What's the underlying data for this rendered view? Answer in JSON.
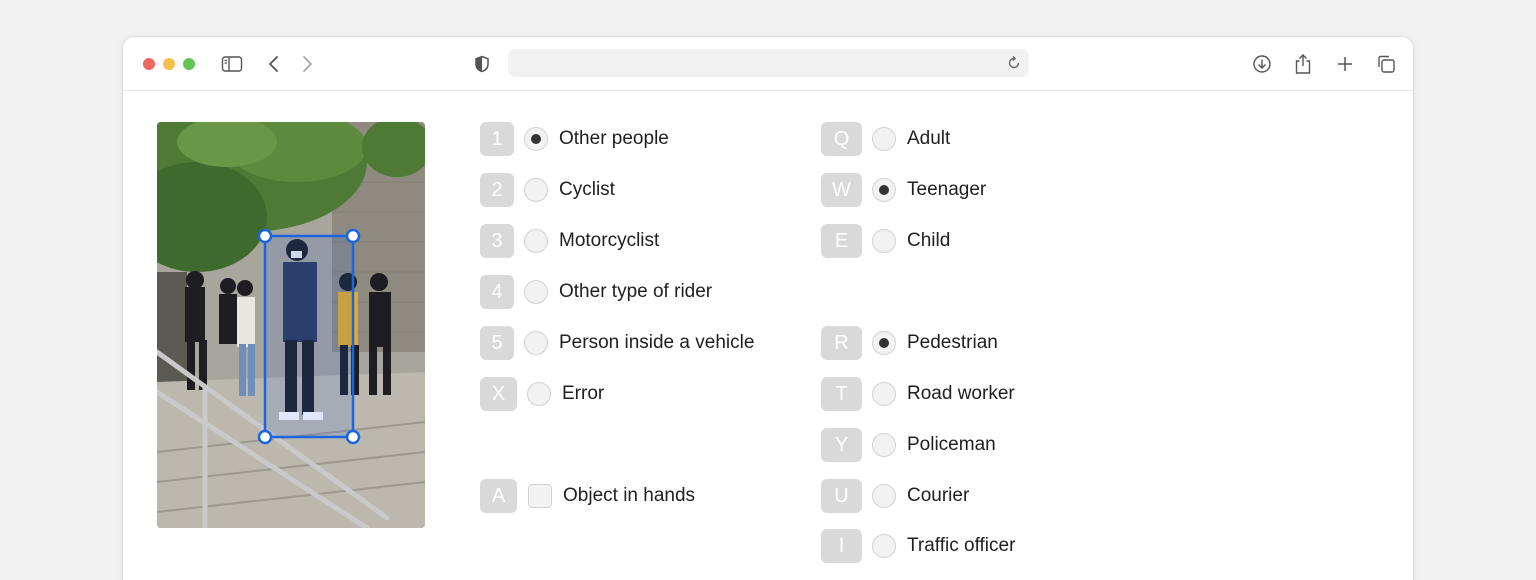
{
  "browser": {
    "traffic_lights": {
      "close": "#ed6a5e",
      "minimize": "#f5bf4f",
      "maximize": "#61c554"
    },
    "address_value": "",
    "icons": [
      "sidebar-icon",
      "back-icon",
      "forward-icon",
      "shield-icon",
      "reload-icon",
      "download-icon",
      "share-icon",
      "new-tab-icon",
      "tabs-overview-icon"
    ]
  },
  "accent_color": "#1a66e0",
  "left_column": [
    {
      "key": "1",
      "label": "Other people",
      "selected": true
    },
    {
      "key": "2",
      "label": "Cyclist",
      "selected": false
    },
    {
      "key": "3",
      "label": "Motorcyclist",
      "selected": false
    },
    {
      "key": "4",
      "label": "Other type of rider",
      "selected": false
    },
    {
      "key": "5",
      "label": "Person inside a vehicle",
      "selected": false
    },
    {
      "key": "X",
      "label": "Error",
      "selected": false
    }
  ],
  "object_in_hands": {
    "key": "A",
    "label": "Object in hands",
    "checked": false
  },
  "age_group": [
    {
      "key": "Q",
      "label": "Adult",
      "selected": false
    },
    {
      "key": "W",
      "label": "Teenager",
      "selected": true
    },
    {
      "key": "E",
      "label": "Child",
      "selected": false
    }
  ],
  "role_group": [
    {
      "key": "R",
      "label": "Pedestrian",
      "selected": true
    },
    {
      "key": "T",
      "label": "Road worker",
      "selected": false
    },
    {
      "key": "Y",
      "label": "Policeman",
      "selected": false
    },
    {
      "key": "U",
      "label": "Courier",
      "selected": false
    },
    {
      "key": "I",
      "label": "Traffic officer",
      "selected": false
    }
  ]
}
